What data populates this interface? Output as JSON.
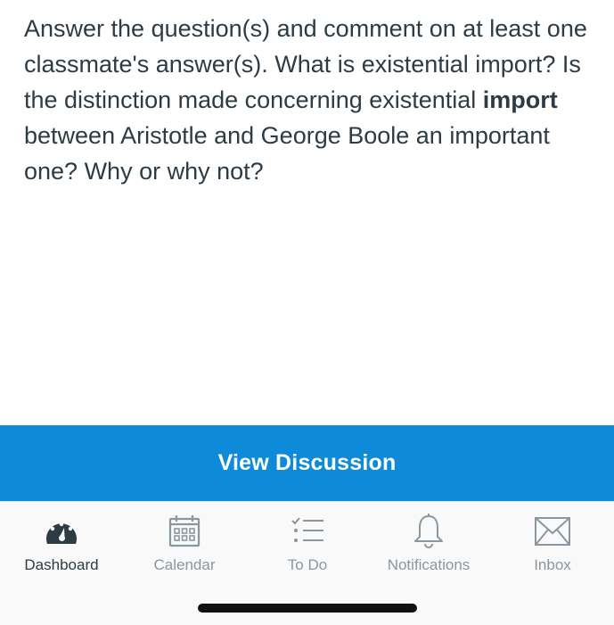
{
  "question": {
    "part1": "Answer the question(s) and comment on at least one classmate's answer(s). What is existential import?  Is the distinction made concerning existential ",
    "bold": "import",
    "part2": " between Aristotle and George Boole an important one?  Why or why not?"
  },
  "view_button": {
    "label": "View Discussion"
  },
  "tabbar": {
    "tabs": [
      {
        "label": "Dashboard",
        "icon": "dashboard-icon",
        "active": true
      },
      {
        "label": "Calendar",
        "icon": "calendar-icon",
        "active": false
      },
      {
        "label": "To Do",
        "icon": "todo-list-icon",
        "active": false
      },
      {
        "label": "Notifications",
        "icon": "bell-icon",
        "active": false
      },
      {
        "label": "Inbox",
        "icon": "envelope-icon",
        "active": false
      }
    ]
  },
  "colors": {
    "accent": "#0e8bd8",
    "text": "#2d3b45",
    "inactive": "#8b969e"
  }
}
